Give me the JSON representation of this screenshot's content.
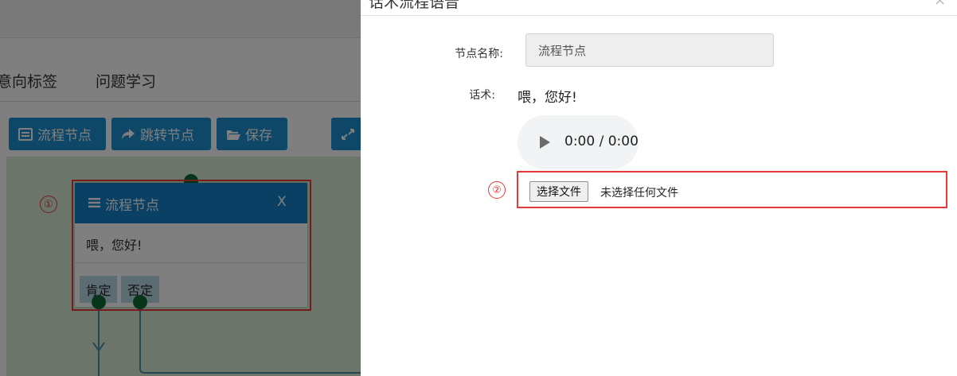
{
  "background": {
    "tabs": [
      {
        "label": "意向标签"
      },
      {
        "label": "问题学习"
      }
    ],
    "toolbar": {
      "flow_node_label": "流程节点",
      "jump_node_label": "跳转节点",
      "save_label": "保存"
    },
    "node_card": {
      "title": "流程节点",
      "close_label": "X",
      "text": "喂，您好!",
      "options": [
        {
          "label": "肯定"
        },
        {
          "label": "否定"
        }
      ]
    },
    "callout_1": "①",
    "toolbar_color": "#1f8fd2",
    "canvas_color": "#d8ebd3"
  },
  "modal": {
    "title": "话术流程语音",
    "close_label": "×",
    "name_label": "节点名称:",
    "name_value": "流程节点",
    "script_label": "话术:",
    "script_text": "喂，您好!",
    "audio_time": "0:00 / 0:00",
    "file_button_label": "选择文件",
    "file_status": "未选择任何文件",
    "callout_2": "②",
    "highlight_color": "#e63b3b"
  }
}
